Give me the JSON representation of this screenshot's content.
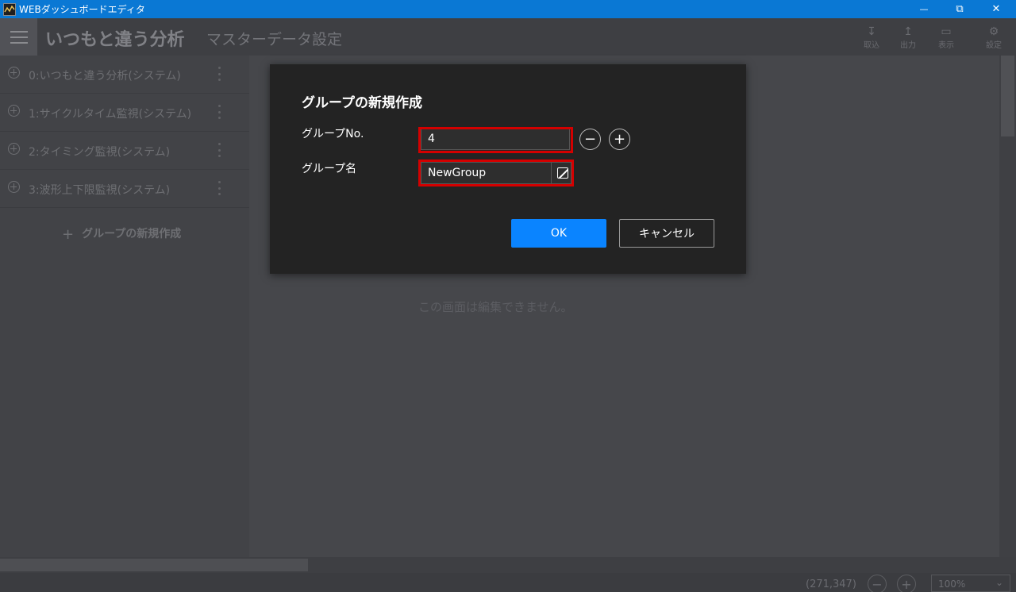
{
  "window": {
    "title": "WEBダッシュボードエディタ",
    "icon": "chart-app-icon",
    "controls": {
      "minimize": "—",
      "restore": "⧉",
      "close": "✕"
    }
  },
  "header": {
    "menu_icon": "hamburger-icon",
    "title": "いつもと違う分析",
    "subtitle": "マスターデータ設定",
    "right_buttons": [
      {
        "icon": "↧",
        "label": "取込"
      },
      {
        "icon": "↥",
        "label": "出力"
      },
      {
        "icon": "▭",
        "label": "表示"
      },
      {
        "icon": "⚙",
        "label": "設定"
      }
    ]
  },
  "sidebar": {
    "items": [
      {
        "label": "0:いつもと違う分析(システム)"
      },
      {
        "label": "1:サイクルタイム監視(システム)"
      },
      {
        "label": "2:タイミング監視(システム)"
      },
      {
        "label": "3:波形上下限監視(システム)"
      }
    ],
    "new_group_plus": "+",
    "new_group_label": "グループの新規作成"
  },
  "canvas": {
    "note": "この画面は編集できません。"
  },
  "status": {
    "coords": "(271,347)",
    "zoom_out": "−",
    "zoom_in": "+",
    "zoom_value": "100%",
    "zoom_chevron": "⌄"
  },
  "dialog": {
    "title": "グループの新規作成",
    "group_no_label": "グループNo.",
    "group_no_value": "4",
    "decrement": "−",
    "increment": "+",
    "group_name_label": "グループ名",
    "group_name_value": "NewGroup",
    "ok_label": "OK",
    "cancel_label": "キャンセル",
    "highlight_color": "#d40000",
    "accent_color": "#0a84ff"
  }
}
